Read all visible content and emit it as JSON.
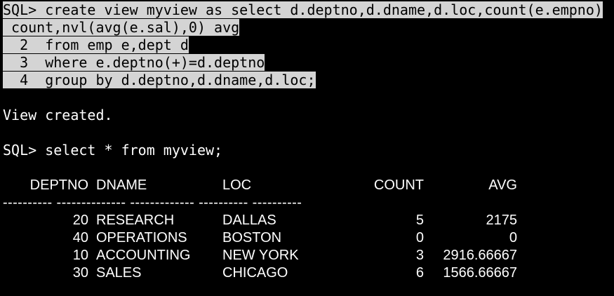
{
  "session": {
    "create_stmt": {
      "line1": "SQL> create view myview as select d.deptno,d.dname,d.loc,count(e.empno)",
      "line2": " count,nvl(avg(e.sal),0) avg",
      "line3": "  2  from emp e,dept d",
      "line4": "  3  where e.deptno(+)=d.deptno",
      "line5": "  4  group by d.deptno,d.dname,d.loc;"
    },
    "view_created": "View created.",
    "select_stmt": "SQL> select * from myview;",
    "columns": [
      "DEPTNO",
      "DNAME",
      "LOC",
      "COUNT",
      "AVG"
    ],
    "separator": "---------- -------------- ------------- ---------- ----------",
    "rows": [
      {
        "deptno": "20",
        "dname": "RESEARCH",
        "loc": "DALLAS",
        "count": "5",
        "avg": "2175"
      },
      {
        "deptno": "40",
        "dname": "OPERATIONS",
        "loc": "BOSTON",
        "count": "0",
        "avg": "0"
      },
      {
        "deptno": "10",
        "dname": "ACCOUNTING",
        "loc": "NEW YORK",
        "count": "3",
        "avg": "2916.66667"
      },
      {
        "deptno": "30",
        "dname": "SALES",
        "loc": "CHICAGO",
        "count": "6",
        "avg": "1566.66667"
      }
    ]
  },
  "colors": {
    "background": "#000000",
    "text": "#ffffff",
    "selection": "#d4d4d4",
    "selection_text": "#000000"
  }
}
